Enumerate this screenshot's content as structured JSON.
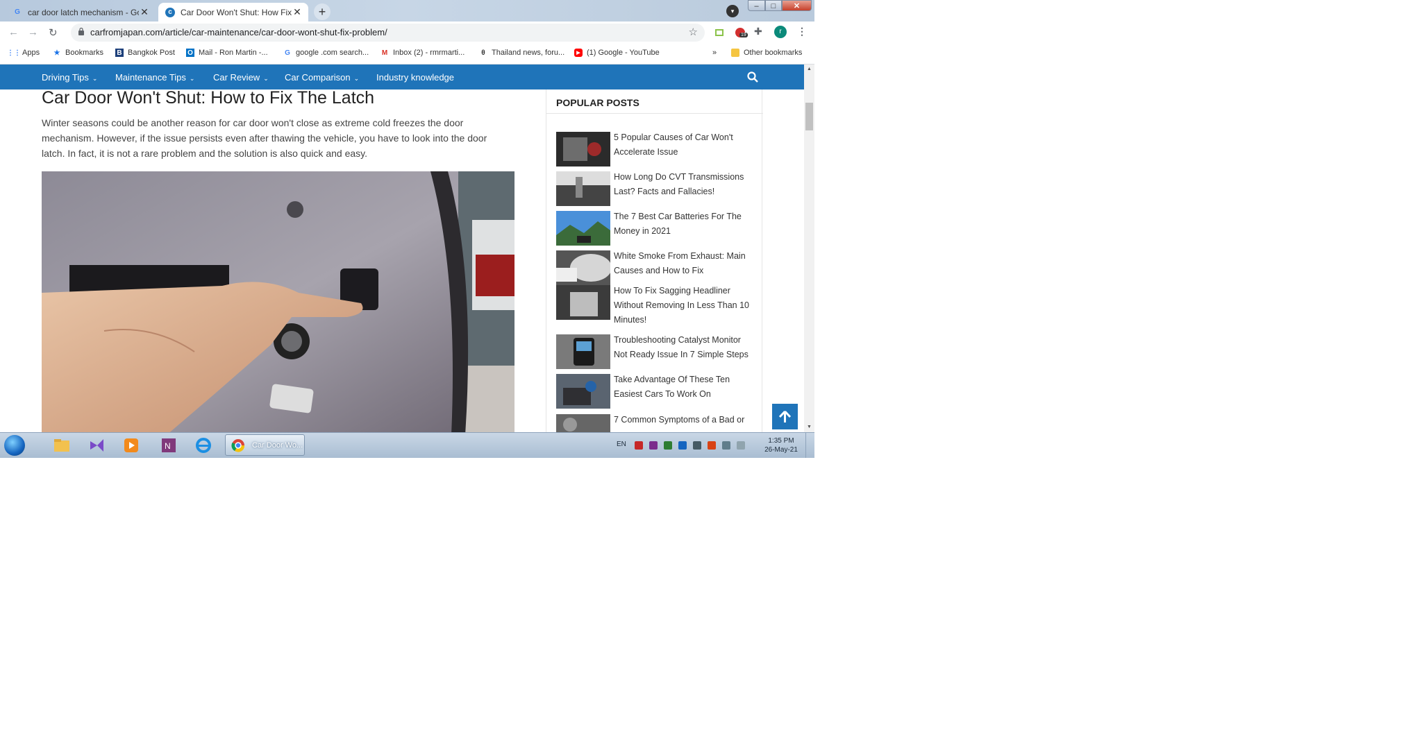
{
  "tabs": [
    {
      "title": "car door latch mechanism - Goog",
      "favicon": "google-g-icon",
      "active": false
    },
    {
      "title": "Car Door Won't Shut: How Fix Th",
      "favicon": "carfromjapan-icon",
      "active": true
    }
  ],
  "toolbar": {
    "url": "carfromjapan.com/article/car-maintenance/car-door-wont-shut-fix-problem/",
    "extension_badge": "19",
    "profile_initial": "r"
  },
  "bookmarks": {
    "items": [
      {
        "label": "Apps",
        "icon": "apps-grid-icon"
      },
      {
        "label": "Bookmarks",
        "icon": "star-icon"
      },
      {
        "label": "Bangkok Post",
        "icon": "bangkok-post-icon"
      },
      {
        "label": "Mail - Ron Martin -...",
        "icon": "outlook-icon"
      },
      {
        "label": "google .com search...",
        "icon": "google-g-icon"
      },
      {
        "label": "Inbox (2) - rmrmarti...",
        "icon": "gmail-icon"
      },
      {
        "label": "Thailand news, foru...",
        "icon": "forum-icon"
      },
      {
        "label": "(1) Google - YouTube",
        "icon": "youtube-icon"
      }
    ],
    "overflow": "»",
    "other": "Other bookmarks"
  },
  "site_nav": {
    "items": [
      "Driving Tips",
      "Maintenance Tips",
      "Car Review",
      "Car Comparison",
      "Industry knowledge"
    ]
  },
  "article": {
    "title": "Car Door Won't Shut: How to Fix The Latch",
    "body": "Winter seasons could be another reason for car door won't close as extreme cold freezes the door mechanism. However, if the issue persists even after thawing the vehicle, you have to look into the door latch. In fact, it is not a rare problem and the solution is also quick and easy."
  },
  "sidebar": {
    "heading": "POPULAR POSTS",
    "posts": [
      "5 Popular Causes of Car Won't Accelerate Issue",
      "How Long Do CVT Transmissions Last? Facts and Fallacies!",
      "The 7 Best Car Batteries For The Money in 2021",
      "White Smoke From Exhaust: Main Causes and How to Fix",
      "How To Fix Sagging Headliner Without Removing In Less Than 10 Minutes!",
      "Troubleshooting Catalyst Monitor Not Ready Issue In 7 Simple Steps",
      "Take Advantage Of These Ten Easiest Cars To Work On",
      "7 Common Symptoms of a Bad or"
    ]
  },
  "taskbar": {
    "active_window": "Car Door Wo...",
    "language": "EN",
    "time": "1:35 PM",
    "date": "26-May-21"
  },
  "colors": {
    "site_nav_blue": "#1f74b9",
    "title_text": "#222222"
  }
}
